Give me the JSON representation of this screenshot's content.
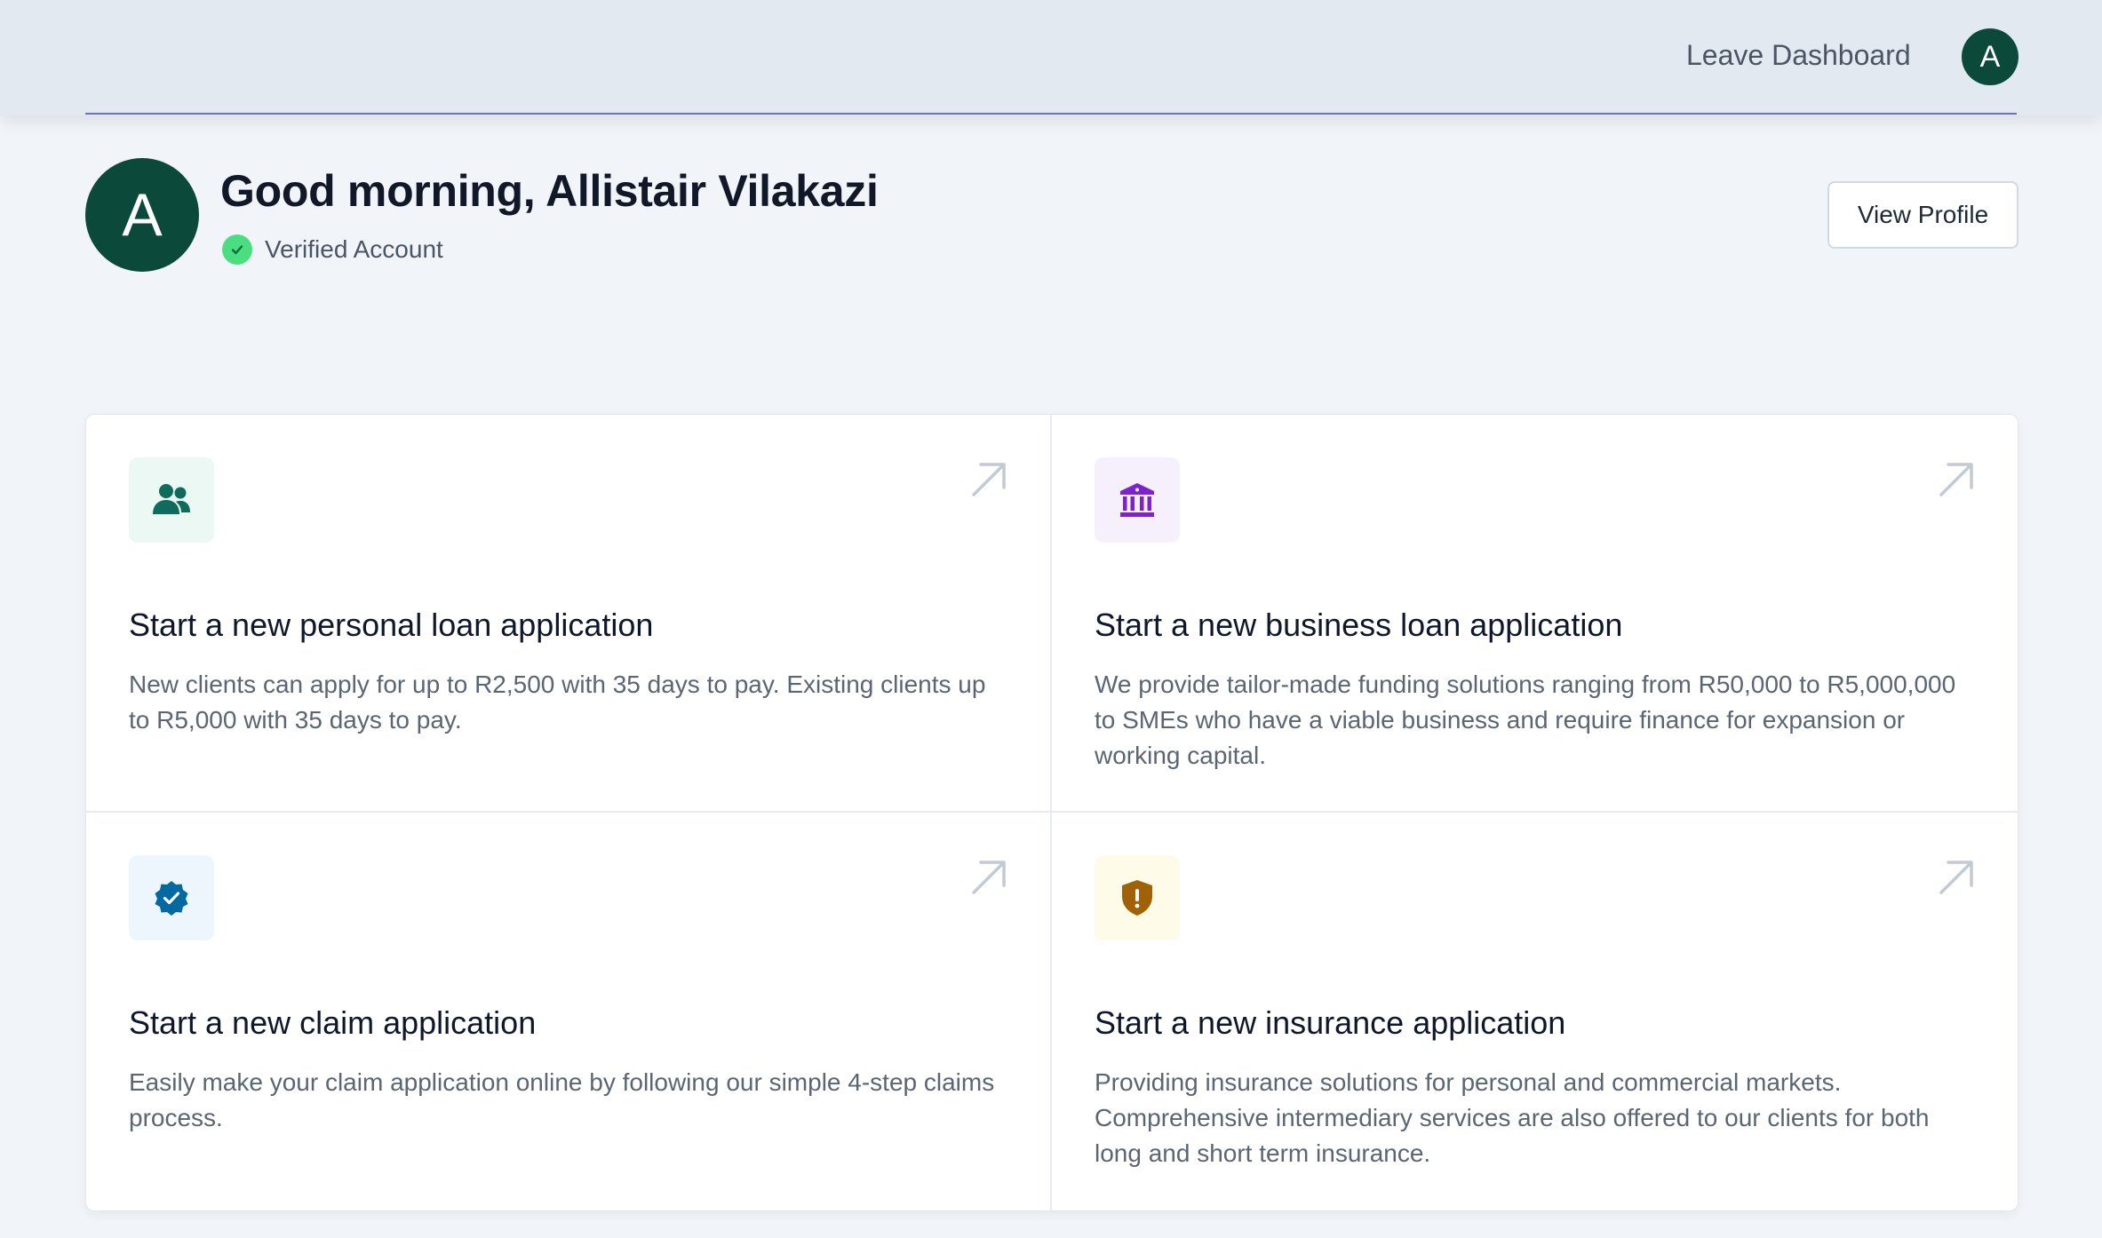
{
  "header": {
    "leave_label": "Leave Dashboard",
    "avatar_letter": "A"
  },
  "greeting": {
    "avatar_letter": "A",
    "title": "Good morning, Allistair Vilakazi",
    "verified_label": "Verified Account",
    "view_profile_label": "View Profile"
  },
  "cards": [
    {
      "title": "Start a new personal loan application",
      "description": "New clients can apply for up to R2,500 with 35 days to pay. Existing clients up to R5,000 with 35 days to pay.",
      "icon": "users-icon",
      "icon_color": "#0f6b5c",
      "icon_bg": "#ecf8f4"
    },
    {
      "title": "Start a new business loan application",
      "description": "We provide tailor-made funding solutions ranging from R50,000 to R5,000,000 to SMEs who have a viable business and require finance for expansion or working capital.",
      "icon": "bank-icon",
      "icon_color": "#7e22ce",
      "icon_bg": "#f6f0fd"
    },
    {
      "title": "Start a new claim application",
      "description": "Easily make your claim application online by following our simple 4-step claims process.",
      "icon": "verified-badge-icon",
      "icon_color": "#0369a1",
      "icon_bg": "#eef6fd"
    },
    {
      "title": "Start a new insurance application",
      "description": "Providing insurance solutions for personal and commercial markets. Comprehensive intermediary services are also offered to our clients for both long and short term insurance.",
      "icon": "shield-alert-icon",
      "icon_color": "#a16207",
      "icon_bg": "#fefbe8"
    }
  ],
  "colors": {
    "brand_green": "#0b4a3b",
    "accent_underline": "#6a6fd8",
    "verified_green": "#4ade80"
  }
}
